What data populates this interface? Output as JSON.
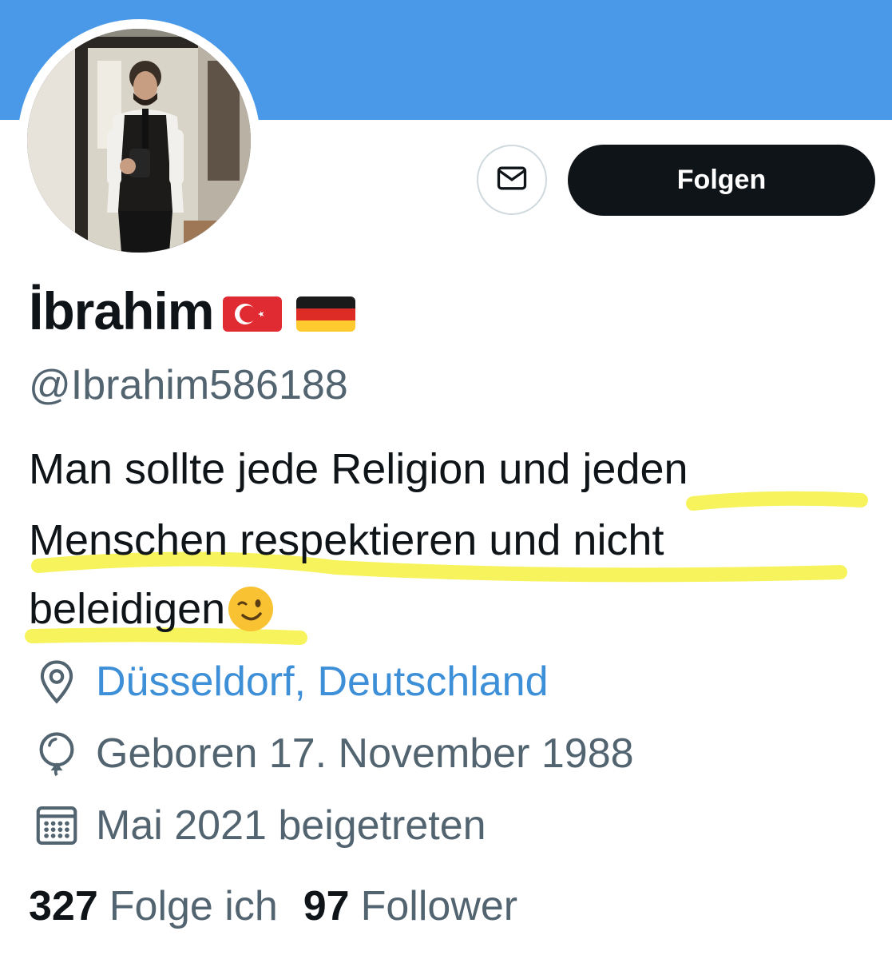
{
  "colors": {
    "banner": "#4a99e9",
    "link": "#3d8fd8",
    "muted": "#536471",
    "text": "#0f1419",
    "button_bg": "#0f1419",
    "highlight": "#f6f24a"
  },
  "header": {
    "message_button_icon": "envelope-icon",
    "follow_label": "Folgen"
  },
  "profile": {
    "display_name": "İbrahim",
    "name_flags": [
      "turkey-flag-emoji",
      "germany-flag-emoji"
    ],
    "handle": "@Ibrahim586188",
    "bio_lines": [
      "Man sollte jede Religion und jeden",
      "Menschen respektieren und nicht",
      "beleidigen"
    ],
    "bio_emoji": "winking-face-emoji",
    "location": "Düsseldorf, Deutschland",
    "birthday": "Geboren 17. November 1988",
    "joined": "Mai 2021 beigetreten"
  },
  "stats": {
    "following_count": "327",
    "following_label": "Folge ich",
    "followers_count": "97",
    "followers_label": "Follower"
  }
}
